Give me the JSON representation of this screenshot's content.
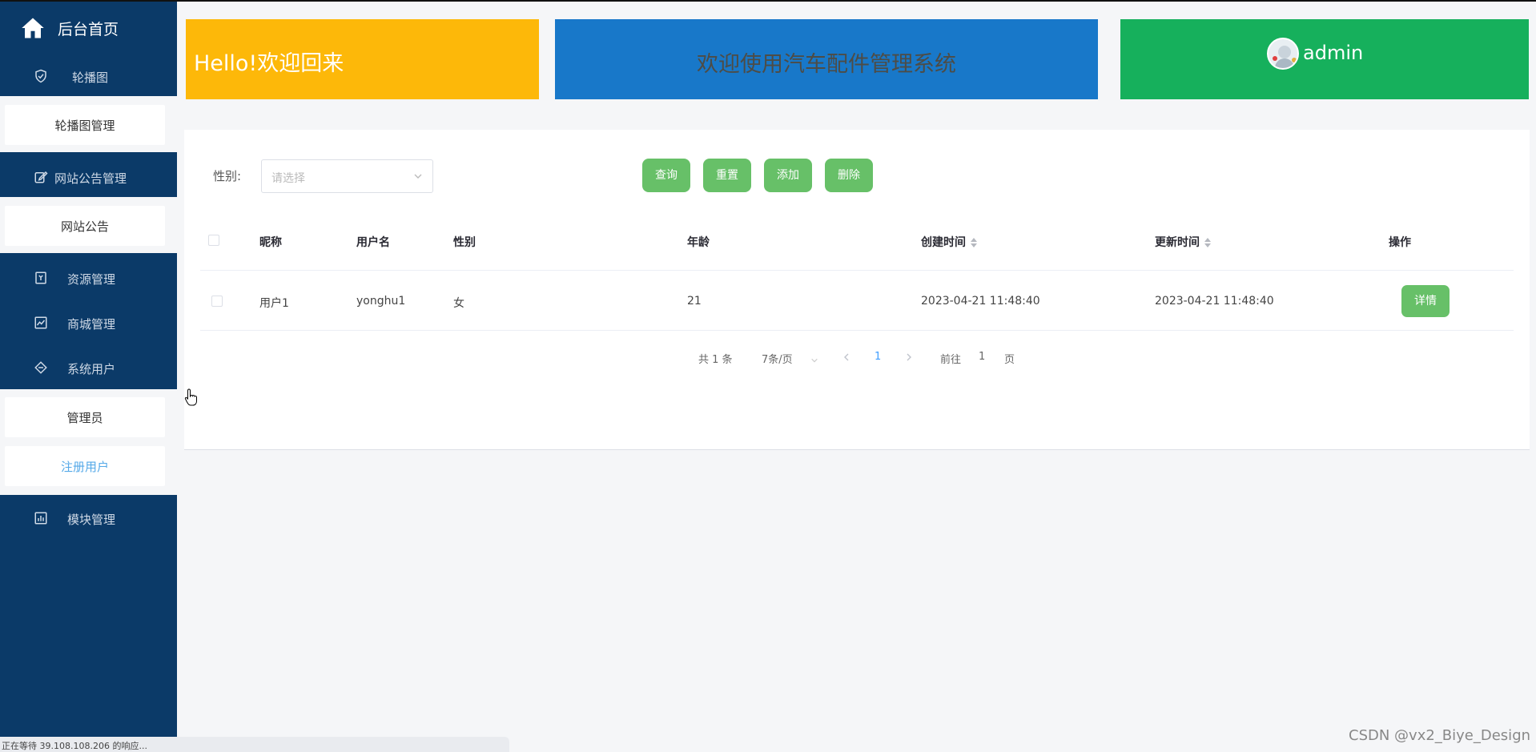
{
  "sidebar": {
    "home_title": "后台首页",
    "items": [
      {
        "label": "轮播图",
        "icon": "shield-check-icon"
      },
      {
        "label": "网站公告管理",
        "icon": "edit-icon"
      },
      {
        "label": "资源管理",
        "icon": "bookmark-icon"
      },
      {
        "label": "商城管理",
        "icon": "chart-line-icon"
      },
      {
        "label": "系统用户",
        "icon": "diamond-icon"
      },
      {
        "label": "模块管理",
        "icon": "bar-chart-icon"
      }
    ],
    "subitems": {
      "carousel_manage": "轮播图管理",
      "site_notice": "网站公告",
      "admin": "管理员",
      "registered_user": "注册用户"
    },
    "colors": {
      "background": "#0b3a68",
      "active_text": "#55a9e8"
    }
  },
  "banners": {
    "welcome": "Hello!欢迎回来",
    "system_title": "欢迎使用汽车配件管理系统",
    "username": "admin",
    "colors": {
      "yellow": "#fdb809",
      "blue": "#1878c9",
      "green": "#16b05c"
    }
  },
  "filter": {
    "gender_label": "性别:",
    "gender_placeholder": "请选择",
    "buttons": {
      "query": "查询",
      "reset": "重置",
      "add": "添加",
      "delete": "删除"
    }
  },
  "table": {
    "headers": {
      "nickname": "昵称",
      "username": "用户名",
      "gender": "性别",
      "age": "年龄",
      "created": "创建时间",
      "updated": "更新时间",
      "action": "操作"
    },
    "rows": [
      {
        "nickname": "用户1",
        "username": "yonghu1",
        "gender": "女",
        "age": "21",
        "created": "2023-04-21 11:48:40",
        "updated": "2023-04-21 11:48:40",
        "action": "详情"
      }
    ]
  },
  "pagination": {
    "total": "共 1 条",
    "page_size": "7条/页",
    "current_page": "1",
    "goto_prefix": "前往",
    "goto_value": "1",
    "goto_suffix": "页"
  },
  "status_bar": "正在等待 39.108.108.206 的响应...",
  "watermark": "CSDN @vx2_Biye_Design"
}
